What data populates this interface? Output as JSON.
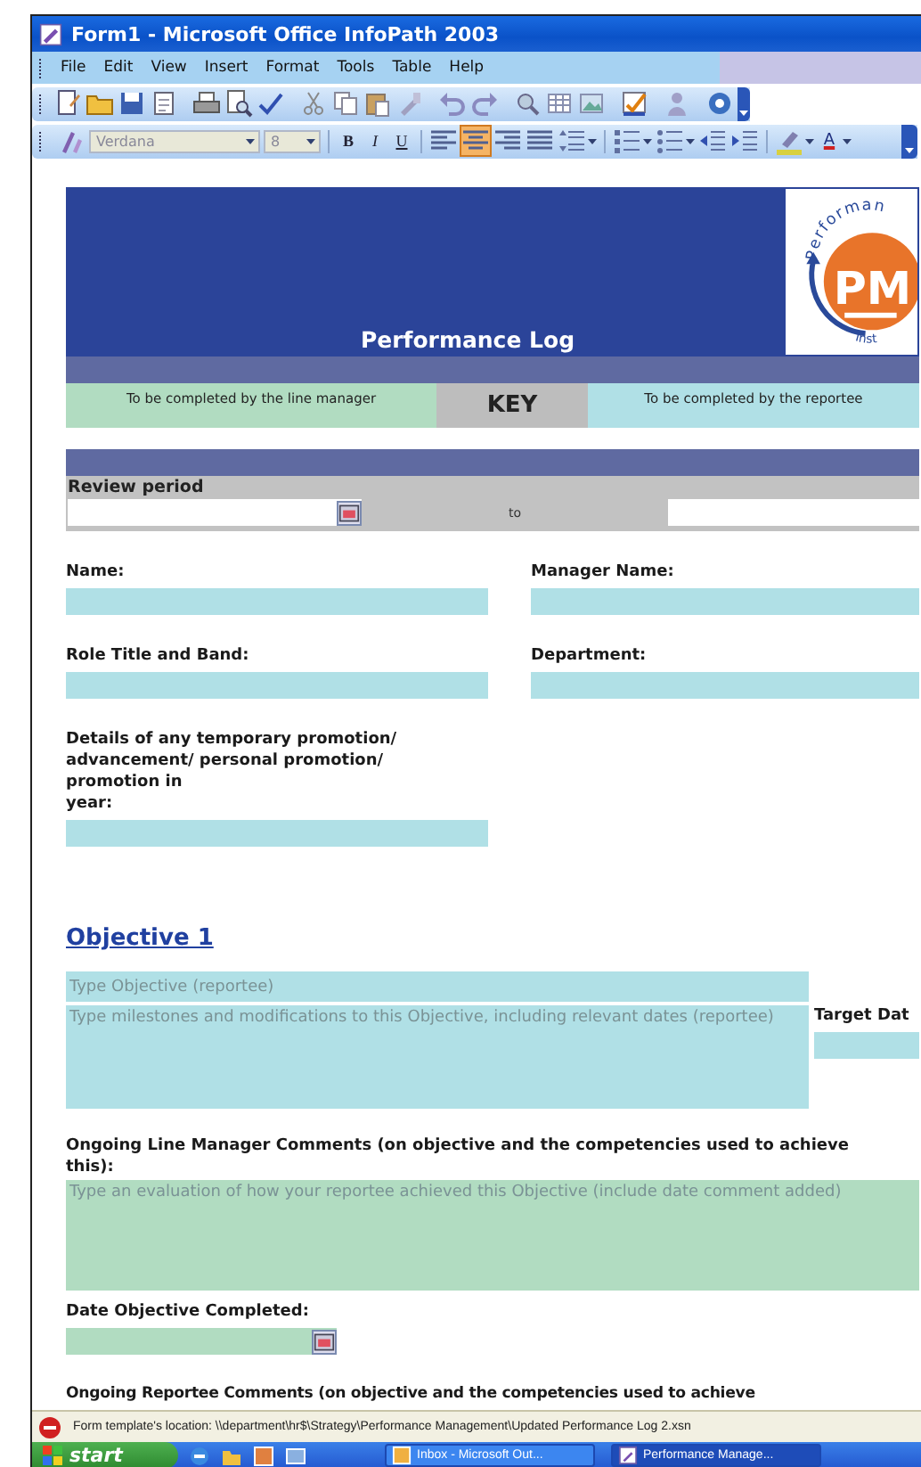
{
  "window": {
    "title": "Form1 - Microsoft Office InfoPath 2003"
  },
  "menu": [
    {
      "label": "File"
    },
    {
      "label": "Edit"
    },
    {
      "label": "View"
    },
    {
      "label": "Insert"
    },
    {
      "label": "Format"
    },
    {
      "label": "Tools"
    },
    {
      "label": "Table"
    },
    {
      "label": "Help"
    }
  ],
  "format_toolbar": {
    "font": "Verdana",
    "size": "8",
    "styles": [
      {
        "label": "B"
      },
      {
        "label": "I"
      },
      {
        "label": "U"
      }
    ],
    "alignments": [
      {
        "selected": false
      },
      {
        "selected": true
      },
      {
        "selected": false
      },
      {
        "selected": false
      }
    ],
    "font_color": "A"
  },
  "form": {
    "title": "Performance Log",
    "logo": {
      "arc_text": "Performan",
      "lower_text": "Inst",
      "initials": "PM"
    },
    "key": [
      {
        "kind": "manager",
        "text": "To be completed by the line manager"
      },
      {
        "kind": "key",
        "text": "KEY"
      },
      {
        "kind": "reportee",
        "text": "To be completed by the reportee"
      }
    ],
    "review_period": {
      "label": "Review period",
      "separator": "to"
    },
    "personal": [
      {
        "label": "Name:",
        "kind": "reportee"
      },
      {
        "label": "Manager Name:",
        "kind": "reportee"
      },
      {
        "label": "Role Title and Band:",
        "kind": "reportee"
      },
      {
        "label": "Department:",
        "kind": "reportee"
      },
      {
        "label": "Details of any temporary promotion/\nadvancement/ personal promotion/\npromotion in\nyear:",
        "kind": "reportee"
      }
    ],
    "objectives": [
      {
        "heading": "Objective 1",
        "objective_field": {
          "placeholder": "Type Objective (reportee)",
          "kind": "reportee"
        },
        "milestones_field": {
          "placeholder": "Type milestones and modifications to this Objective, including relevant dates (reportee)",
          "kind": "reportee"
        },
        "target_date": {
          "label": "Target Dat",
          "kind": "reportee"
        },
        "manager_comments": {
          "label": "Ongoing Line Manager Comments (on objective and the competencies used to achieve this):",
          "placeholder": "Type an evaluation of how your reportee achieved this Objective (include date comment added)",
          "kind": "manager"
        },
        "date_completed": {
          "label": "Date Objective Completed:",
          "kind": "manager"
        },
        "reportee_comments": {
          "label": "Ongoing Reportee Comments (on objective and the competencies used to achieve"
        }
      }
    ]
  },
  "status_bar": {
    "text": "Form template's location: \\\\department\\hr$\\Strategy\\Performance Management\\Updated Performance Log 2.xsn"
  },
  "taskbar": {
    "start": "start",
    "tasks": [
      {
        "label": "Inbox - Microsoft Out...",
        "selected": false
      },
      {
        "label": "Performance Manage...",
        "selected": true
      }
    ]
  }
}
